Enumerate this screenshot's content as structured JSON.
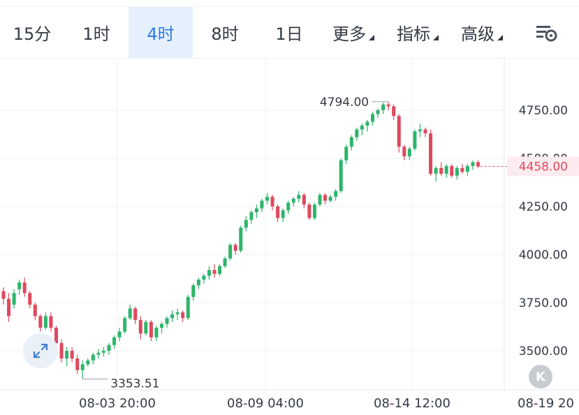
{
  "tabs": [
    {
      "label": "15分",
      "active": false,
      "has_caret": false
    },
    {
      "label": "1时",
      "active": false,
      "has_caret": false
    },
    {
      "label": "4时",
      "active": true,
      "has_caret": false
    },
    {
      "label": "8时",
      "active": false,
      "has_caret": false
    },
    {
      "label": "1日",
      "active": false,
      "has_caret": false
    },
    {
      "label": "更多",
      "active": false,
      "has_caret": true
    },
    {
      "label": "指标",
      "active": false,
      "has_caret": true
    },
    {
      "label": "高级",
      "active": false,
      "has_caret": true
    }
  ],
  "icons": {
    "settings": "chart-settings-icon",
    "expand": "expand-arrows-icon",
    "back": "jump-to-latest-icon"
  },
  "back_button_label": "K",
  "colors": {
    "up": "#2db56a",
    "down": "#e0485e",
    "active_tab": "#2e7be0",
    "grid": "#eef0f3",
    "price_tag_bg": "#fdecef"
  },
  "chart_data": {
    "type": "candlestick",
    "y_ticks": [
      "4750.00",
      "4500.00",
      "4250.00",
      "4000.00",
      "3750.00",
      "3500.00"
    ],
    "x_ticks": [
      "08-03 20:00",
      "08-09 04:00",
      "08-14 12:00",
      "08-19 20"
    ],
    "current_price": "4458.00",
    "high_label": "4794.00",
    "low_label": "3353.51",
    "ylim": [
      3300,
      4900
    ],
    "grid": true,
    "ohlc": [
      [
        3810,
        3830,
        3740,
        3770
      ],
      [
        3770,
        3800,
        3650,
        3680
      ],
      [
        3740,
        3820,
        3720,
        3800
      ],
      [
        3820,
        3870,
        3790,
        3855
      ],
      [
        3855,
        3880,
        3780,
        3800
      ],
      [
        3800,
        3810,
        3720,
        3740
      ],
      [
        3740,
        3750,
        3660,
        3680
      ],
      [
        3680,
        3690,
        3600,
        3620
      ],
      [
        3620,
        3700,
        3610,
        3680
      ],
      [
        3680,
        3700,
        3600,
        3620
      ],
      [
        3620,
        3630,
        3520,
        3540
      ],
      [
        3540,
        3560,
        3440,
        3460
      ],
      [
        3460,
        3520,
        3420,
        3500
      ],
      [
        3500,
        3520,
        3440,
        3460
      ],
      [
        3460,
        3480,
        3380,
        3400
      ],
      [
        3400,
        3450,
        3353.51,
        3430
      ],
      [
        3430,
        3460,
        3420,
        3450
      ],
      [
        3450,
        3490,
        3430,
        3480
      ],
      [
        3480,
        3510,
        3460,
        3490
      ],
      [
        3490,
        3520,
        3470,
        3500
      ],
      [
        3500,
        3540,
        3480,
        3530
      ],
      [
        3530,
        3580,
        3510,
        3570
      ],
      [
        3570,
        3620,
        3550,
        3600
      ],
      [
        3600,
        3680,
        3590,
        3670
      ],
      [
        3670,
        3740,
        3660,
        3720
      ],
      [
        3720,
        3730,
        3640,
        3660
      ],
      [
        3660,
        3680,
        3560,
        3590
      ],
      [
        3590,
        3660,
        3580,
        3650
      ],
      [
        3650,
        3660,
        3550,
        3570
      ],
      [
        3570,
        3630,
        3550,
        3620
      ],
      [
        3620,
        3650,
        3590,
        3640
      ],
      [
        3640,
        3680,
        3620,
        3670
      ],
      [
        3670,
        3710,
        3650,
        3690
      ],
      [
        3690,
        3720,
        3660,
        3700
      ],
      [
        3700,
        3710,
        3650,
        3670
      ],
      [
        3670,
        3790,
        3660,
        3780
      ],
      [
        3780,
        3850,
        3760,
        3840
      ],
      [
        3840,
        3880,
        3820,
        3870
      ],
      [
        3870,
        3900,
        3850,
        3890
      ],
      [
        3890,
        3940,
        3870,
        3920
      ],
      [
        3920,
        3950,
        3880,
        3900
      ],
      [
        3900,
        3950,
        3890,
        3940
      ],
      [
        3940,
        3990,
        3930,
        3980
      ],
      [
        3980,
        4060,
        3970,
        4050
      ],
      [
        4050,
        4060,
        4000,
        4020
      ],
      [
        4020,
        4150,
        4010,
        4140
      ],
      [
        4140,
        4200,
        4120,
        4180
      ],
      [
        4180,
        4230,
        4160,
        4220
      ],
      [
        4220,
        4260,
        4190,
        4240
      ],
      [
        4240,
        4290,
        4220,
        4280
      ],
      [
        4280,
        4320,
        4260,
        4300
      ],
      [
        4300,
        4310,
        4230,
        4250
      ],
      [
        4250,
        4260,
        4170,
        4190
      ],
      [
        4190,
        4240,
        4170,
        4230
      ],
      [
        4230,
        4280,
        4210,
        4270
      ],
      [
        4270,
        4300,
        4250,
        4290
      ],
      [
        4290,
        4330,
        4270,
        4310
      ],
      [
        4310,
        4320,
        4240,
        4260
      ],
      [
        4260,
        4270,
        4180,
        4190
      ],
      [
        4190,
        4270,
        4180,
        4260
      ],
      [
        4260,
        4320,
        4250,
        4310
      ],
      [
        4310,
        4320,
        4260,
        4280
      ],
      [
        4280,
        4310,
        4270,
        4300
      ],
      [
        4300,
        4340,
        4280,
        4330
      ],
      [
        4330,
        4500,
        4320,
        4490
      ],
      [
        4490,
        4570,
        4470,
        4560
      ],
      [
        4560,
        4620,
        4540,
        4610
      ],
      [
        4610,
        4660,
        4590,
        4650
      ],
      [
        4650,
        4680,
        4620,
        4670
      ],
      [
        4670,
        4700,
        4640,
        4690
      ],
      [
        4690,
        4740,
        4670,
        4730
      ],
      [
        4730,
        4760,
        4710,
        4750
      ],
      [
        4750,
        4790,
        4730,
        4780
      ],
      [
        4780,
        4794,
        4750,
        4770
      ],
      [
        4770,
        4780,
        4700,
        4720
      ],
      [
        4720,
        4730,
        4530,
        4560
      ],
      [
        4560,
        4570,
        4490,
        4510
      ],
      [
        4510,
        4560,
        4490,
        4550
      ],
      [
        4550,
        4650,
        4540,
        4640
      ],
      [
        4640,
        4680,
        4610,
        4650
      ],
      [
        4650,
        4660,
        4610,
        4630
      ],
      [
        4630,
        4650,
        4410,
        4420
      ],
      [
        4420,
        4460,
        4380,
        4450
      ],
      [
        4450,
        4480,
        4410,
        4420
      ],
      [
        4420,
        4470,
        4400,
        4460
      ],
      [
        4460,
        4470,
        4400,
        4410
      ],
      [
        4410,
        4460,
        4390,
        4450
      ],
      [
        4450,
        4470,
        4420,
        4430
      ],
      [
        4430,
        4470,
        4410,
        4460
      ],
      [
        4460,
        4490,
        4440,
        4480
      ],
      [
        4480,
        4490,
        4450,
        4458
      ]
    ]
  }
}
